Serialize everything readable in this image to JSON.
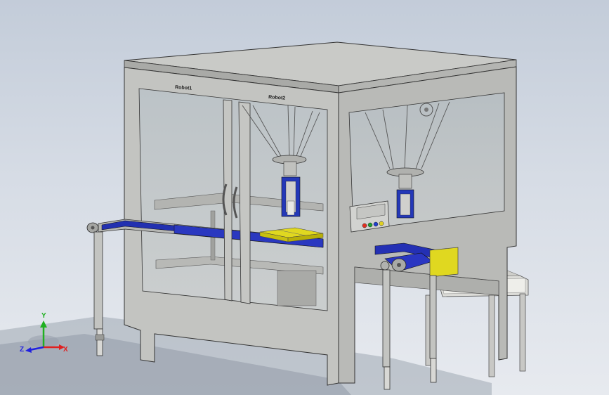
{
  "viewport": {
    "background_top": "#c3ccd9",
    "background_bottom": "#e7eaef"
  },
  "model": {
    "robot1_label": "Robot1",
    "robot2_label": "Robot2",
    "frame_color": "#c2c3c0",
    "conveyor_color": "#2230b0",
    "tray_color": "#e0d820",
    "panel_buttons": [
      "#e03020",
      "#20a030",
      "#2040d0",
      "#e0d020"
    ]
  },
  "triad": {
    "x": "X",
    "y": "Y",
    "z": "Z",
    "x_color": "#e02020",
    "y_color": "#20b020",
    "z_color": "#2020e0"
  }
}
